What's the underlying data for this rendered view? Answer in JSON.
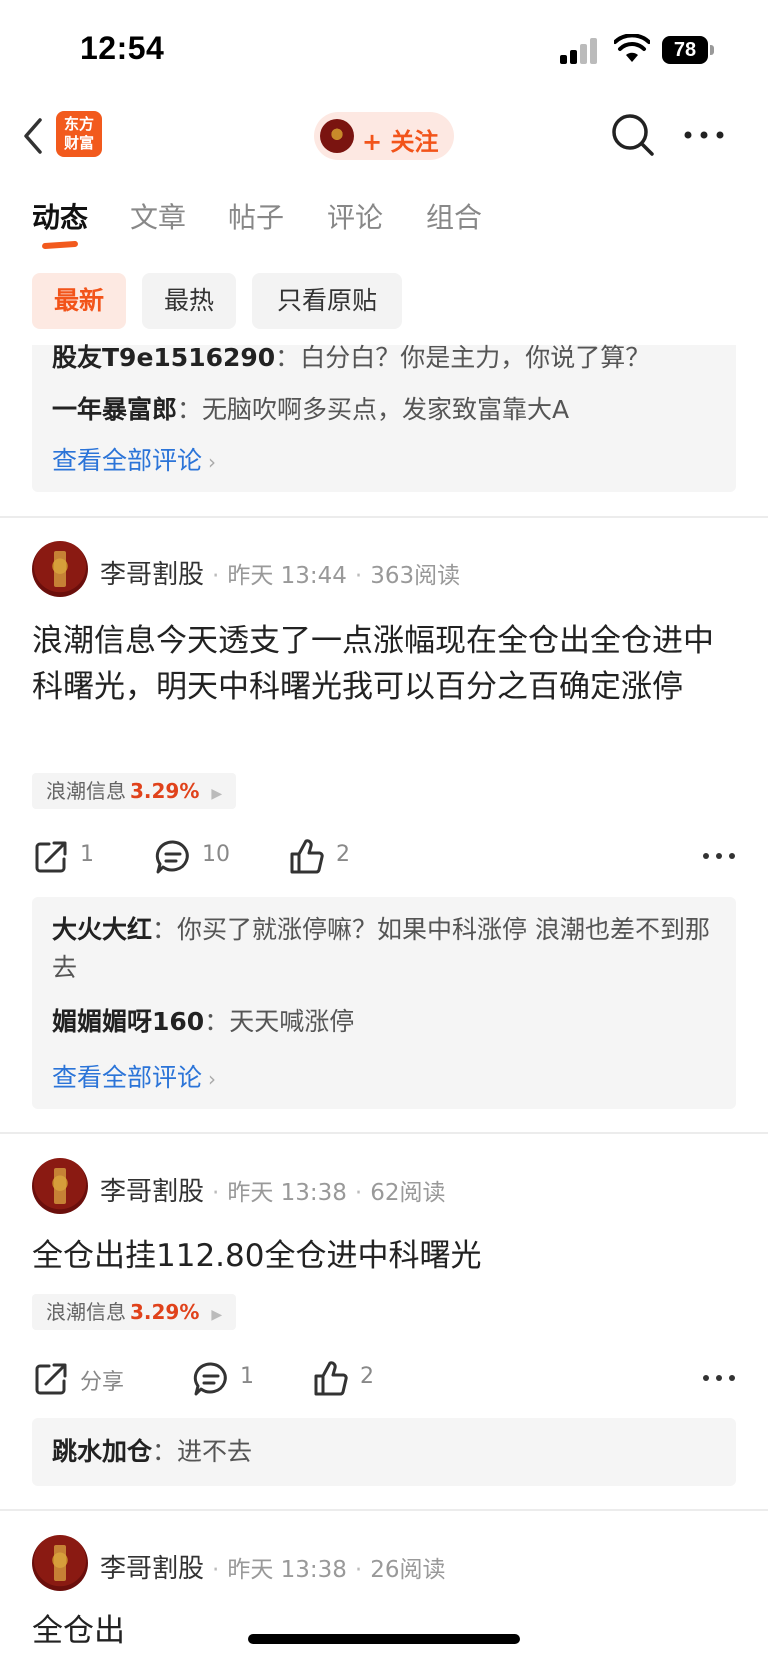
{
  "status": {
    "time": "12:54",
    "battery": "78"
  },
  "nav": {
    "logo_text": "东方\n财富",
    "follow_label": "+ 关注"
  },
  "tabs": [
    {
      "label": "动态",
      "active": true
    },
    {
      "label": "文章",
      "active": false
    },
    {
      "label": "帖子",
      "active": false
    },
    {
      "label": "评论",
      "active": false
    },
    {
      "label": "组合",
      "active": false
    }
  ],
  "filters": [
    {
      "label": "最新",
      "active": true
    },
    {
      "label": "最热",
      "active": false
    },
    {
      "label": "只看原贴",
      "active": false
    }
  ],
  "prev_comments": {
    "items": [
      {
        "author": "股友T9e1516290",
        "sep": "：",
        "text": "白分白？你是主力，你说了算？"
      },
      {
        "author": "一年暴富郎",
        "sep": "：",
        "text": "无脑吹啊多买点，发家致富靠大A"
      }
    ],
    "see_all": "查看全部评论"
  },
  "posts": [
    {
      "author": "李哥割股",
      "time": "昨天 13:44",
      "reads": "363阅读",
      "text": "浪潮信息今天透支了一点涨幅现在全仓出全仓进中科曙光，明天中科曙光我可以百分之百确定涨停",
      "stock": {
        "name": "浪潮信息",
        "change": "3.29%"
      },
      "share": "1",
      "comments": "10",
      "likes": "2",
      "comment_list": [
        {
          "author": "大火大红",
          "sep": "：",
          "text": "你买了就涨停嘛？如果中科涨停 浪潮也差不到那去"
        },
        {
          "author": "媚媚媚呀160",
          "sep": "：",
          "text": "天天喊涨停"
        }
      ],
      "see_all": "查看全部评论"
    },
    {
      "author": "李哥割股",
      "time": "昨天 13:38",
      "reads": "62阅读",
      "text": "全仓出挂112.80全仓进中科曙光",
      "stock": {
        "name": "浪潮信息",
        "change": "3.29%"
      },
      "share": "分享",
      "comments": "1",
      "likes": "2",
      "comment_list": [
        {
          "author": "跳水加仓",
          "sep": "：",
          "text": "进不去"
        }
      ]
    },
    {
      "author": "李哥割股",
      "time": "昨天 13:38",
      "reads": "26阅读",
      "text": "全仓出"
    }
  ],
  "colors": {
    "accent": "#f25a1d",
    "link": "#2b74d8",
    "rise": "#e0421b"
  }
}
